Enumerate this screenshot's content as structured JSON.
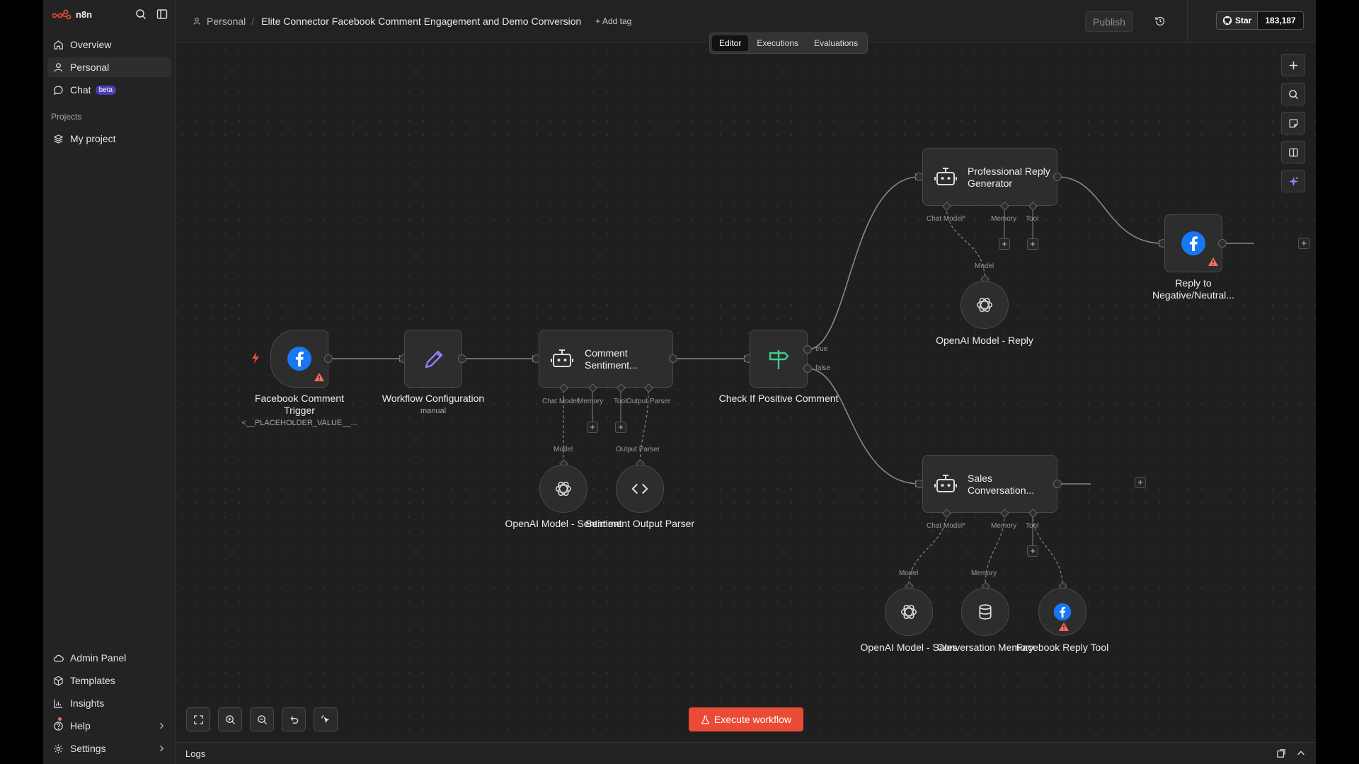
{
  "app": {
    "brand": "n8n"
  },
  "sidebar": {
    "items": [
      {
        "label": "Overview",
        "icon": "home-icon"
      },
      {
        "label": "Personal",
        "icon": "user-icon",
        "active": true
      },
      {
        "label": "Chat",
        "icon": "chat-icon",
        "badge": "beta"
      }
    ],
    "projects_label": "Projects",
    "projects": [
      {
        "label": "My project",
        "icon": "layers-icon"
      }
    ],
    "bottom_items": [
      {
        "label": "Admin Panel",
        "icon": "cloud-icon"
      },
      {
        "label": "Templates",
        "icon": "package-icon"
      },
      {
        "label": "Insights",
        "icon": "chart-icon"
      },
      {
        "label": "Help",
        "icon": "help-icon"
      },
      {
        "label": "Settings",
        "icon": "gear-icon"
      }
    ]
  },
  "header": {
    "breadcrumb_project": "Personal",
    "workflow_title": "Elite Connector Facebook Comment Engagement and Demo Conversion",
    "add_tag": "+ Add tag",
    "publish": "Publish",
    "github_star": "Star",
    "github_count": "183,187",
    "tabs": [
      "Editor",
      "Executions",
      "Evaluations"
    ]
  },
  "nodes": {
    "fb_trigger": {
      "label": "Facebook Comment Trigger",
      "sub": "<__PLACEHOLDER_VALUE__..."
    },
    "workflow_config": {
      "label": "Workflow Configuration",
      "sub": "manual"
    },
    "comment_sentiment": {
      "title": "Comment Sentiment...",
      "ports": [
        "Chat Model",
        "Memory",
        "Tool",
        "Output Parser"
      ]
    },
    "openai_sentiment": {
      "label": "OpenAI Model - Sentiment",
      "port": "Model"
    },
    "sentiment_parser": {
      "label": "Sentiment Output Parser",
      "port": "Output Parser"
    },
    "check_positive": {
      "label": "Check If Positive Comment",
      "true_label": "true",
      "false_label": "false"
    },
    "professional_reply": {
      "title": "Professional Reply Generator",
      "ports": [
        "Chat Model",
        "Memory",
        "Tool"
      ],
      "required_mark": "*"
    },
    "openai_reply": {
      "label": "OpenAI Model - Reply",
      "port": "Model"
    },
    "reply_negative": {
      "label": "Reply to Negative/Neutral..."
    },
    "sales_conversation": {
      "title": "Sales Conversation...",
      "ports": [
        "Chat Model",
        "Memory",
        "Tool"
      ],
      "required_mark": "*"
    },
    "openai_sales": {
      "label": "OpenAI Model - Sales",
      "port": "Model"
    },
    "conversation_memory": {
      "label": "Conversation Memory",
      "port": "Memory"
    },
    "fb_reply_tool": {
      "label": "Facebook Reply Tool"
    }
  },
  "canvas": {
    "execute_button": "Execute workflow"
  },
  "logs": {
    "label": "Logs"
  },
  "colors": {
    "accent": "#ea4b36",
    "facebook": "#1877f2",
    "warning": "#ff6d5a",
    "filter_green": "#3fcf8e",
    "edit_purple": "#8b83f8"
  }
}
